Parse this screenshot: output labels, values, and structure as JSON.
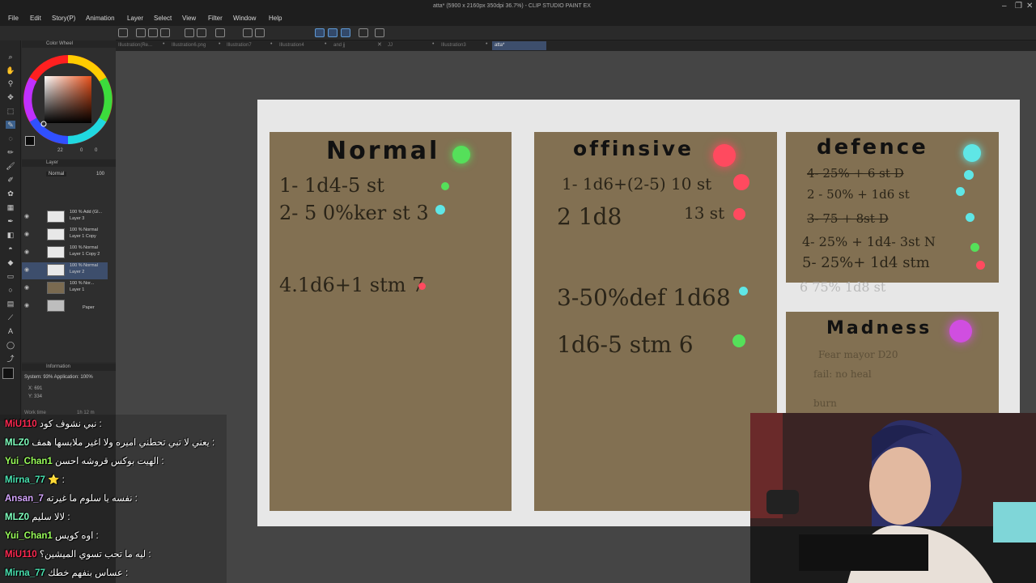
{
  "window": {
    "title": "atta* (5900 x 2160px 350dpi 36.7%) - CLIP STUDIO PAINT EX",
    "menu": [
      "File",
      "Edit",
      "Story(P)",
      "Animation",
      "Layer",
      "Select",
      "View",
      "Filter",
      "Window",
      "Help"
    ]
  },
  "tabs": [
    {
      "label": "Illustration(Re..."
    },
    {
      "label": "Illustration6.png"
    },
    {
      "label": "Illustration7"
    },
    {
      "label": "Illustration4"
    },
    {
      "label": "and jj"
    },
    {
      "label": "JJ"
    },
    {
      "label": "Illustration3"
    },
    {
      "label": "atta*"
    }
  ],
  "color_wheel": {
    "title": "Color Wheel",
    "values": [
      "22",
      "0",
      "0"
    ]
  },
  "layer_panel": {
    "title": "Layer",
    "mode": "Normal",
    "opacity": "100",
    "layers": [
      {
        "mode": "100 % Add (Gl...",
        "name": "Layer 3"
      },
      {
        "mode": "100 % Normal",
        "name": "Layer 1 Copy"
      },
      {
        "mode": "100 % Normal",
        "name": "Layer 1 Copy 2"
      },
      {
        "mode": "100 % Normal",
        "name": "Layer 2"
      },
      {
        "mode": "100 % Nor...",
        "name": "Layer 1"
      },
      {
        "mode": "",
        "name": "Paper"
      }
    ]
  },
  "info_panel": {
    "title": "Information",
    "system": "System: 93%  Application: 100%",
    "x": "X: 691",
    "y": "Y: 334",
    "work_time_label": "Work time",
    "work_time": "1h 12 m"
  },
  "canvas": {
    "card1": {
      "title": "Normal",
      "lines": [
        "1- 1d4-5 st",
        "2- 5 0%ker st 3",
        "4.1d6+1 stm 7"
      ]
    },
    "card2": {
      "title": "offinsive",
      "lines": [
        "1- 1d6+(2-5) 10 st",
        "2 1d8",
        "13 st",
        "3-50%def 1d68",
        "1d6-5 stm 6"
      ]
    },
    "card3": {
      "title": "defence",
      "lines": [
        "4- 25% + 6 st D",
        "2 - 50% + 1d6 st",
        "3- 75 + 8st D",
        "4- 25% + 1d4- 3st N",
        "5- 25%+ 1d4 stm",
        "6 75% 1d8 st"
      ]
    },
    "card4": {
      "title": "Madness",
      "lines": [
        "Fear mayor D20",
        "fail: no heal",
        "burn"
      ]
    }
  },
  "chat": [
    {
      "user": "MiU110",
      "message": "نبي نشوف كود :",
      "color": "#ff2a52"
    },
    {
      "user": "MLZ0",
      "message": "يعني لا تبي تحطني اميره ولا اغير ملابسها همف :",
      "color": "#7fffbd"
    },
    {
      "user": "Yui_Chan1",
      "message": "الهيت بوكس قروشه احسن :",
      "color": "#9aff5a"
    },
    {
      "user": "Mirna_77",
      "message": "⭐ :",
      "color": "#49e2b0"
    },
    {
      "user": "Ansan_7",
      "message": "نفسه يا سلوم ما غيرته :",
      "color": "#d6a6ff"
    },
    {
      "user": "MLZ0",
      "message": "لالا سليم :",
      "color": "#7fffbd"
    },
    {
      "user": "Yui_Chan1",
      "message": "اوه كويس :",
      "color": "#9aff5a"
    },
    {
      "user": "MiU110",
      "message": "ليه ما تحب تسوي الميشين؟ :",
      "color": "#ff2a52"
    },
    {
      "user": "Mirna_77",
      "message": "عساس بنفهم خطك :",
      "color": "#49e2b0"
    }
  ],
  "colors": {
    "green": "#55e05a",
    "red": "#ff4a5f",
    "cyan": "#5fe6e6",
    "magenta": "#d04ee0",
    "card": "#827052",
    "tab_active": "#3d4e6c"
  }
}
